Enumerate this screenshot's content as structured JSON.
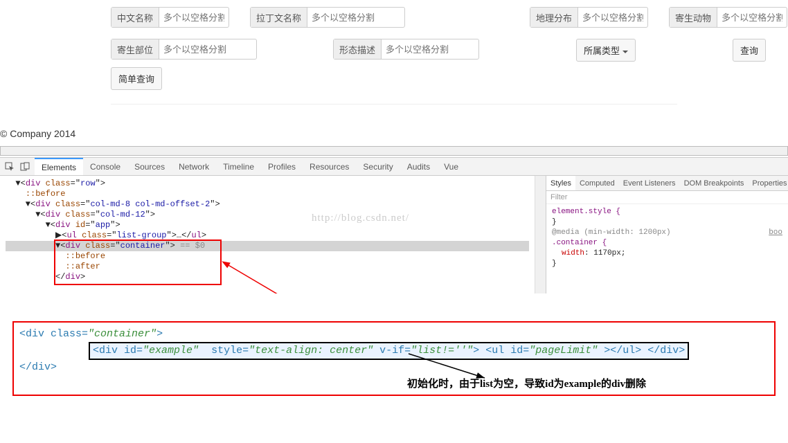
{
  "form": {
    "cnName": {
      "label": "中文名称",
      "placeholder": "多个以空格分割"
    },
    "latinName": {
      "label": "拉丁文名称",
      "placeholder": "多个以空格分割"
    },
    "geoDist": {
      "label": "地理分布",
      "placeholder": "多个以空格分割"
    },
    "hostAnimal": {
      "label": "寄生动物",
      "placeholder": "多个以空格分割"
    },
    "hostPart": {
      "label": "寄生部位",
      "placeholder": "多个以空格分割"
    },
    "morphDesc": {
      "label": "形态描述",
      "placeholder": "多个以空格分割"
    },
    "typeBtn": "所属类型",
    "queryBtn": "查询",
    "simpleQueryBtn": "简单查询"
  },
  "footer": "© Company 2014",
  "watermark": "http://blog.csdn.net/",
  "devtools": {
    "tabs": [
      "Elements",
      "Console",
      "Sources",
      "Network",
      "Timeline",
      "Profiles",
      "Resources",
      "Security",
      "Audits",
      "Vue"
    ],
    "activeTab": "Elements",
    "stylesTabs": [
      "Styles",
      "Computed",
      "Event Listeners",
      "DOM Breakpoints",
      "Properties"
    ],
    "activeStylesTab": "Styles",
    "filterPlaceholder": "Filter",
    "dom": {
      "l1": "▼<div class=\"row\">",
      "l2": "  ::before",
      "l3": "  ▼<div class=\"col-md-8 col-md-offset-2\">",
      "l4": "    ▼<div class=\"col-md-12\">",
      "l5": "      ▼<div id=\"app\">",
      "l6": "        ▶<ul class=\"list-group\">…</ul>",
      "l7": "        ▼<div class=\"container\"> == $0",
      "l8": "          ::before",
      "l9": "          ::after",
      "l10": "        </div>"
    },
    "styles": {
      "r1": "element.style {",
      "r2": "}",
      "r3": "@media (min-width: 1200px)",
      "r4": ".container {",
      "r5": "width",
      "r5v": ": 1170px;",
      "r6": "}",
      "link": "boo"
    }
  },
  "codeBlock": {
    "line1_a": "<div ",
    "line1_b": "class=",
    "line1_c": "\"container\"",
    "line1_d": ">",
    "line2": "<div id=\"example\"  style=\"text-align: center\" v-if=\"list!=''\"> <ul id=\"pageLimit\" ></ul> </div>",
    "line3": "</div>"
  },
  "caption": "初始化时，由于list为空，导致id为example的div删除"
}
